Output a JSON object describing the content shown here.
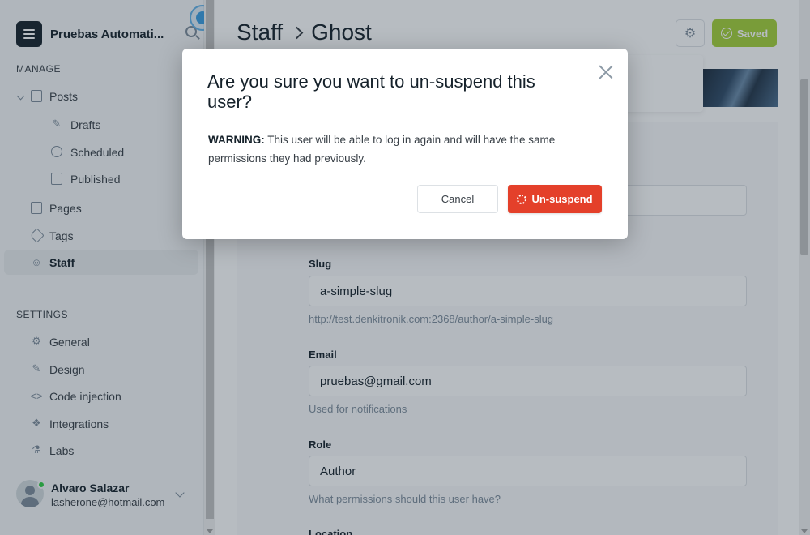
{
  "sidebar": {
    "brand_title": "Pruebas Automati...",
    "manage_label": "MANAGE",
    "settings_label": "SETTINGS",
    "items": {
      "posts": "Posts",
      "drafts": "Drafts",
      "scheduled": "Scheduled",
      "published": "Published",
      "pages": "Pages",
      "tags": "Tags",
      "staff": "Staff",
      "general": "General",
      "design": "Design",
      "code_injection": "Code injection",
      "integrations": "Integrations",
      "labs": "Labs"
    },
    "user": {
      "name": "Alvaro Salazar",
      "email": "lasherone@hotmail.com"
    }
  },
  "header": {
    "crumb_parent": "Staff",
    "crumb_current": "Ghost",
    "saved_label": "Saved"
  },
  "form": {
    "slug_label": "Slug",
    "slug_value": "a-simple-slug",
    "slug_hint": "http://test.denkitronik.com:2368/author/a-simple-slug",
    "email_label": "Email",
    "email_value": "pruebas@gmail.com",
    "email_hint": "Used for notifications",
    "role_label": "Role",
    "role_value": "Author",
    "role_hint": "What permissions should this user have?",
    "location_label": "Location"
  },
  "modal": {
    "title": "Are you sure you want to un-suspend this user?",
    "warning_label": "WARNING:",
    "warning_text": "This user will be able to log in again and will have the same permissions they had previously.",
    "cancel_label": "Cancel",
    "confirm_label": "Un-suspend"
  },
  "colors": {
    "accent_green": "#a4d037",
    "danger_red": "#e4402a",
    "overlay": "rgba(30,48,62,0.32)"
  }
}
